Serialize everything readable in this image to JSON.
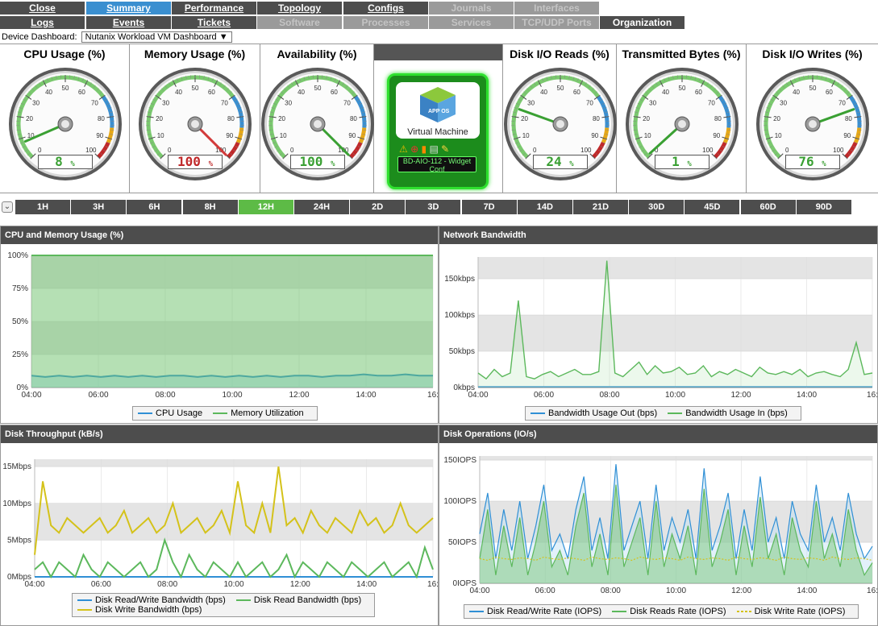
{
  "tabs_row1": [
    {
      "label": "Close",
      "state": "normal"
    },
    {
      "label": "Summary",
      "state": "selected"
    },
    {
      "label": "Performance",
      "state": "normal"
    },
    {
      "label": "Topology",
      "state": "normal"
    },
    {
      "label": "Configs",
      "state": "normal"
    },
    {
      "label": "Journals",
      "state": "disabled"
    },
    {
      "label": "Interfaces",
      "state": "disabled"
    }
  ],
  "tabs_row2": [
    {
      "label": "Logs",
      "state": "normal"
    },
    {
      "label": "Events",
      "state": "normal"
    },
    {
      "label": "Tickets",
      "state": "normal"
    },
    {
      "label": "Software",
      "state": "disabled"
    },
    {
      "label": "Processes",
      "state": "disabled"
    },
    {
      "label": "Services",
      "state": "disabled"
    },
    {
      "label": "TCP/UDP Ports",
      "state": "disabled"
    },
    {
      "label": "Organization",
      "state": "normal"
    }
  ],
  "device_dashboard": {
    "label": "Device Dashboard:",
    "value": "Nutanix Workload VM Dashboard"
  },
  "gauges": [
    {
      "title": "CPU Usage (%)",
      "value": 8,
      "display": "8",
      "unit": "%",
      "color": "green"
    },
    {
      "title": "Memory Usage (%)",
      "value": 100,
      "display": "100",
      "unit": "%",
      "color": "red"
    },
    {
      "title": "Availability (%)",
      "value": 100,
      "display": "100",
      "unit": "%",
      "color": "green"
    },
    {
      "title": "Disk I/O Reads (%)",
      "value": 24,
      "display": "24",
      "unit": "%",
      "color": "green"
    },
    {
      "title": "Transmitted Bytes (%)",
      "value": 1,
      "display": "1",
      "unit": "%",
      "color": "green"
    },
    {
      "title": "Disk I/O Writes (%)",
      "value": 76,
      "display": "76",
      "unit": "%",
      "color": "green"
    }
  ],
  "gauge_ticks": [
    "0",
    "10",
    "20",
    "30",
    "40",
    "50",
    "60",
    "70",
    "80",
    "90",
    "100"
  ],
  "vm": {
    "icon_label": "APP OS",
    "label": "Virtual Machine",
    "name": "BD-AIO-112 - Widget Conf",
    "status_icons": [
      "warning-icon",
      "lifebuoy-icon",
      "signal-icon",
      "printer-icon",
      "wrench-icon"
    ]
  },
  "time_ranges": [
    "1H",
    "3H",
    "6H",
    "8H",
    "12H",
    "24H",
    "2D",
    "3D",
    "7D",
    "14D",
    "21D",
    "30D",
    "45D",
    "60D",
    "90D"
  ],
  "time_range_selected": "12H",
  "colors": {
    "tab": "#4d4d4d",
    "tab_selected": "#3a8fd0",
    "range_selected": "#5dbb46",
    "series_blue": "#2f8fd5",
    "series_green": "#5cb85c",
    "series_yellow": "#d4c21a",
    "grid_band": "#e2e2e2"
  },
  "x_ticks": [
    "04:00",
    "06:00",
    "08:00",
    "10:00",
    "12:00",
    "14:00",
    "16:"
  ],
  "chart_data": [
    {
      "type": "area",
      "title": "CPU and Memory Usage (%)",
      "y_ticks": [
        "0%",
        "25%",
        "50%",
        "75%",
        "100%"
      ],
      "ylim": [
        0,
        100
      ],
      "series": [
        {
          "name": "CPU Usage",
          "color": "#2f8fd5",
          "values": [
            9,
            8,
            9,
            8,
            9,
            8,
            9,
            8,
            9,
            8,
            9,
            9,
            8,
            9,
            8,
            9,
            8,
            9,
            8,
            9,
            9,
            8,
            9,
            9,
            10,
            9,
            9,
            10,
            9,
            9
          ]
        },
        {
          "name": "Memory Utilization",
          "color": "#5cb85c",
          "values": [
            100,
            100,
            100,
            100,
            100,
            100,
            100,
            100,
            100,
            100,
            100,
            100,
            100,
            100,
            100,
            100,
            100,
            100,
            100,
            100,
            100,
            100,
            100,
            100,
            100,
            100,
            100,
            100,
            100,
            100
          ]
        }
      ]
    },
    {
      "type": "line",
      "title": "Network Bandwidth",
      "y_ticks": [
        "0kbps",
        "50kbps",
        "100kbps",
        "150kbps"
      ],
      "ylim": [
        0,
        180
      ],
      "series": [
        {
          "name": "Bandwidth Usage Out (bps)",
          "color": "#2f8fd5",
          "values": [
            1,
            1,
            1,
            1,
            1,
            1,
            1,
            1,
            1,
            1,
            1,
            1,
            1,
            1,
            1,
            1,
            1,
            1,
            1,
            1,
            1,
            1,
            1,
            1,
            1,
            1,
            1,
            1,
            1,
            1,
            1,
            1,
            1,
            1,
            1,
            1,
            1,
            1,
            1,
            1,
            1,
            1,
            1,
            1,
            1,
            1,
            1,
            1,
            1,
            1
          ]
        },
        {
          "name": "Bandwidth Usage In (bps)",
          "color": "#5cb85c",
          "values": [
            20,
            12,
            25,
            15,
            20,
            120,
            15,
            12,
            18,
            22,
            15,
            20,
            25,
            18,
            18,
            22,
            175,
            20,
            15,
            25,
            35,
            18,
            30,
            20,
            22,
            28,
            18,
            20,
            30,
            15,
            22,
            18,
            25,
            20,
            15,
            28,
            20,
            18,
            22,
            18,
            25,
            15,
            20,
            22,
            18,
            15,
            25,
            62,
            18,
            20
          ]
        }
      ]
    },
    {
      "type": "line",
      "title": "Disk Throughput (kB/s)",
      "y_ticks": [
        "0Mbps",
        "5Mbps",
        "10Mbps",
        "15Mbps"
      ],
      "ylim": [
        0,
        16
      ],
      "series": [
        {
          "name": "Disk Read/Write Bandwidth (bps)",
          "color": "#2f8fd5",
          "values": [
            0,
            0,
            0,
            0,
            0,
            0,
            0,
            0,
            0,
            0,
            0,
            0,
            0,
            0,
            0,
            0,
            0,
            0,
            0,
            0,
            0,
            0,
            0,
            0,
            0,
            0,
            0,
            0,
            0,
            0,
            0,
            0,
            0,
            0,
            0,
            0,
            0,
            0,
            0,
            0,
            0,
            0,
            0,
            0,
            0,
            0,
            0,
            0,
            0,
            0
          ]
        },
        {
          "name": "Disk Read Bandwidth (bps)",
          "color": "#5cb85c",
          "values": [
            1,
            2,
            0,
            2,
            1,
            0,
            3,
            1,
            0,
            2,
            1,
            0,
            1,
            2,
            0,
            1,
            5,
            2,
            0,
            3,
            1,
            0,
            2,
            1,
            0,
            2,
            0,
            1,
            2,
            0,
            1,
            3,
            0,
            2,
            1,
            0,
            2,
            1,
            0,
            2,
            1,
            0,
            1,
            2,
            0,
            1,
            2,
            0,
            4,
            1
          ]
        },
        {
          "name": "Disk Write Bandwidth (bps)",
          "color": "#d4c21a",
          "values": [
            3,
            13,
            7,
            6,
            8,
            7,
            6,
            7,
            8,
            6,
            7,
            9,
            6,
            7,
            8,
            6,
            7,
            10,
            6,
            7,
            8,
            6,
            7,
            9,
            6,
            13,
            7,
            6,
            10,
            6,
            15,
            7,
            8,
            6,
            9,
            7,
            6,
            8,
            7,
            6,
            9,
            7,
            8,
            6,
            7,
            10,
            7,
            6,
            7,
            8
          ]
        }
      ]
    },
    {
      "type": "area",
      "title": "Disk Operations (IO/s)",
      "y_ticks": [
        "0IOPS",
        "50IOPS",
        "100IOPS",
        "150IOPS"
      ],
      "ylim": [
        0,
        155
      ],
      "series": [
        {
          "name": "Disk Read/Write Rate (IOPS)",
          "color": "#2f8fd5",
          "values": [
            60,
            110,
            30,
            90,
            40,
            100,
            30,
            70,
            120,
            40,
            60,
            30,
            90,
            130,
            40,
            80,
            30,
            145,
            40,
            70,
            100,
            30,
            120,
            40,
            80,
            50,
            90,
            30,
            140,
            40,
            70,
            110,
            30,
            90,
            40,
            130,
            50,
            80,
            30,
            100,
            60,
            40,
            120,
            50,
            80,
            40,
            110,
            60,
            30,
            45
          ]
        },
        {
          "name": "Disk Reads Rate (IOPS)",
          "color": "#5cb85c",
          "values": [
            30,
            90,
            10,
            70,
            20,
            80,
            10,
            50,
            100,
            20,
            40,
            10,
            70,
            110,
            20,
            60,
            10,
            120,
            20,
            50,
            80,
            10,
            100,
            20,
            60,
            30,
            70,
            10,
            115,
            20,
            50,
            90,
            10,
            70,
            20,
            105,
            30,
            60,
            10,
            80,
            40,
            20,
            100,
            30,
            60,
            20,
            90,
            40,
            10,
            25
          ]
        },
        {
          "name": "Disk Write Rate (IOPS)",
          "color": "#d4c21a",
          "values": [
            30,
            28,
            32,
            30,
            29,
            31,
            30,
            28,
            32,
            30,
            29,
            31,
            30,
            28,
            32,
            30,
            29,
            31,
            30,
            28,
            32,
            30,
            29,
            31,
            30,
            28,
            32,
            30,
            29,
            31,
            30,
            28,
            32,
            30,
            29,
            31,
            30,
            28,
            32,
            30,
            29,
            31,
            30,
            28,
            32,
            30,
            29,
            31,
            30,
            28
          ]
        }
      ]
    }
  ]
}
